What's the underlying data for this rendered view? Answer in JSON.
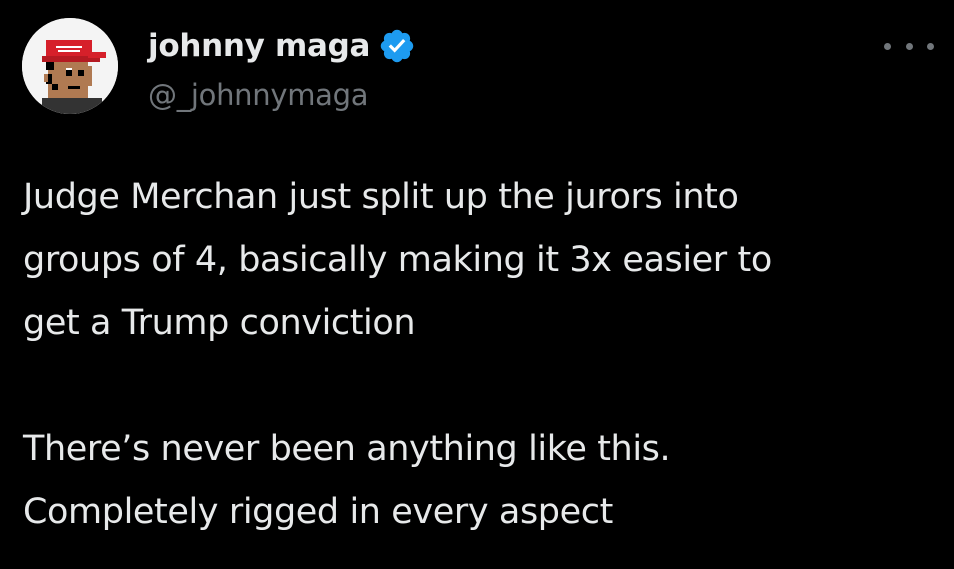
{
  "tweet": {
    "author": {
      "display_name": "johnny maga",
      "handle": "@_johnnymaga",
      "verified": true,
      "avatar_icon": "pixel-art-avatar-red-cap",
      "verified_icon": "verified-badge-icon"
    },
    "more_icon": "more-options-icon",
    "paragraphs": [
      "Judge Merchan just split up the jurors into\ngroups of 4, basically making it 3x easier to\nget a Trump conviction",
      "There’s never been anything like this.\nCompletely rigged in every aspect"
    ]
  },
  "colors": {
    "background": "#000000",
    "primary_text": "#e7e9ea",
    "secondary_text": "#71767b",
    "verified_blue": "#1d9bf0",
    "cap_red": "#d6202a"
  }
}
